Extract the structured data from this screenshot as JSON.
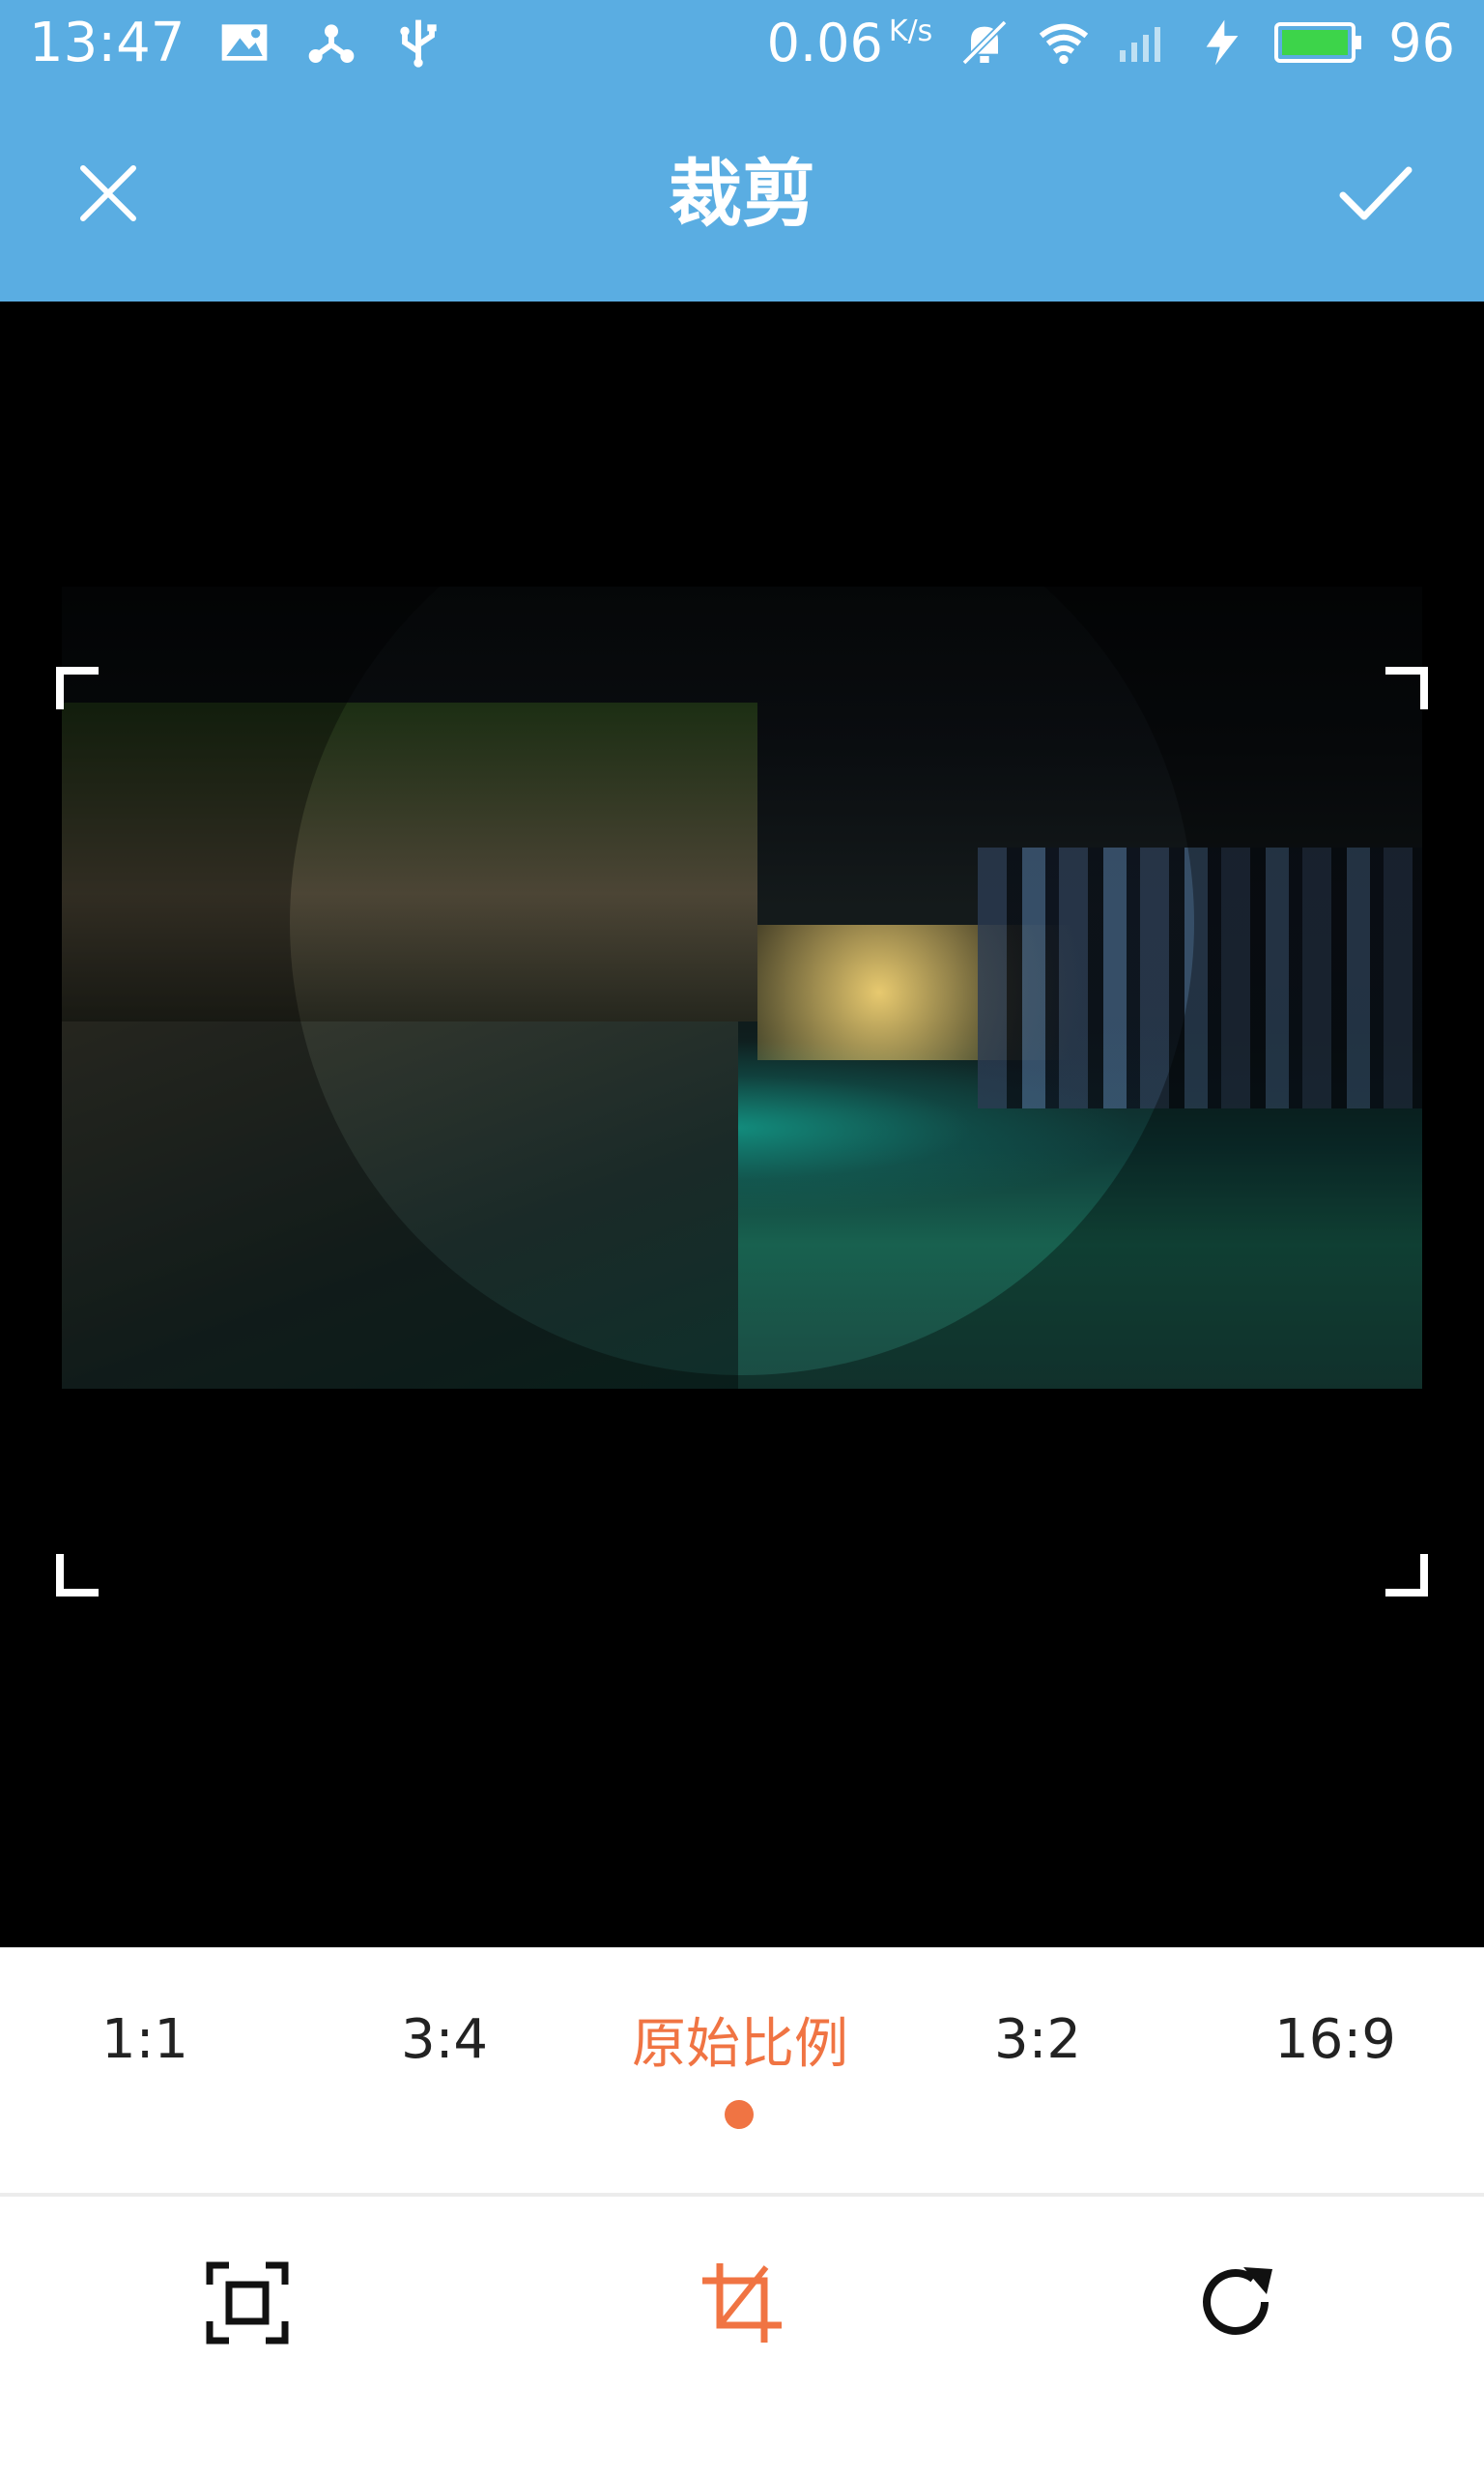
{
  "status_bar": {
    "time": "13:47",
    "network_speed": "0.06",
    "network_speed_unit": "K/s",
    "battery_level": "96",
    "icons": [
      "image-notification-icon",
      "share-icon",
      "usb-icon",
      "mute-icon",
      "wifi-icon",
      "signal-icon",
      "charging-icon",
      "battery-icon"
    ]
  },
  "header": {
    "title": "裁剪",
    "close_icon": "close-icon",
    "confirm_icon": "check-icon"
  },
  "aspect_ratios": [
    {
      "label": "1:1",
      "selected": false
    },
    {
      "label": "3:4",
      "selected": false
    },
    {
      "label": "原始比例",
      "selected": true
    },
    {
      "label": "3:2",
      "selected": false
    },
    {
      "label": "16:9",
      "selected": false
    }
  ],
  "toolbar": {
    "tools": [
      {
        "icon": "fit-frame-icon",
        "active": false
      },
      {
        "icon": "crop-icon",
        "active": true
      },
      {
        "icon": "rotate-icon",
        "active": false
      }
    ]
  },
  "colors": {
    "header_bg": "#5aade2",
    "accent": "#f07443",
    "canvas_bg": "#000000"
  }
}
